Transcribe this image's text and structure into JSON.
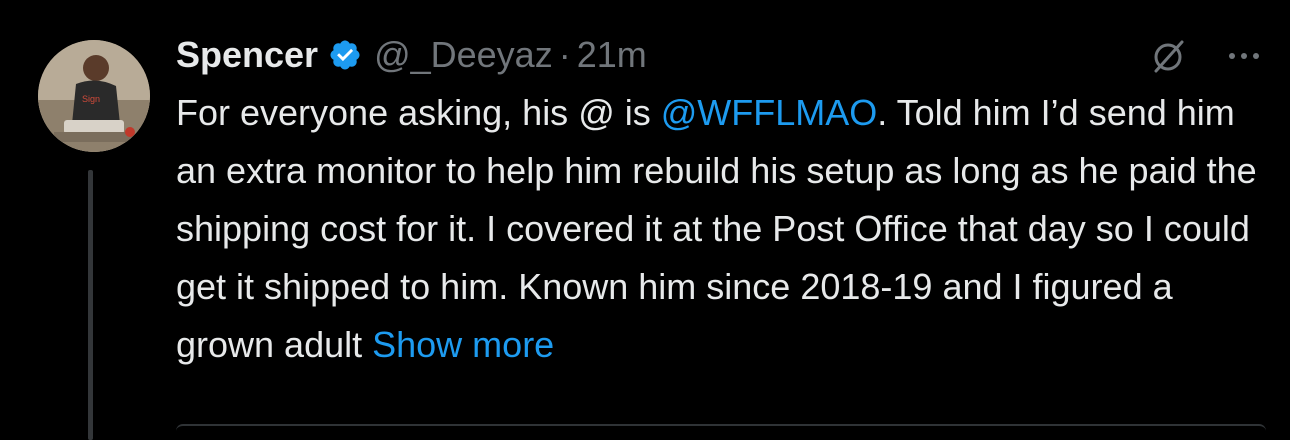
{
  "tweet": {
    "display_name": "Spencer",
    "verified_icon": "verified-badge-icon",
    "handle": "@_Deeyaz",
    "separator": "·",
    "time": "21m",
    "body": {
      "part1": "For everyone asking, his @ is ",
      "mention": "@WFFLMAO",
      "part2": ". Told him I’d send him an extra monitor to help him rebuild his setup as long as he paid the shipping cost for it. I covered it at the Post Office that day so I could get it shipped to him. Known him since 2018-19 and I figured a grown adult ",
      "show_more": "Show more"
    },
    "icons": {
      "mute": "grok-slash-icon",
      "more": "more-options-icon"
    },
    "colors": {
      "background": "#000000",
      "text": "#e7e9ea",
      "muted": "#71767b",
      "link": "#1d9bf0",
      "verified": "#1d9bf0"
    }
  }
}
